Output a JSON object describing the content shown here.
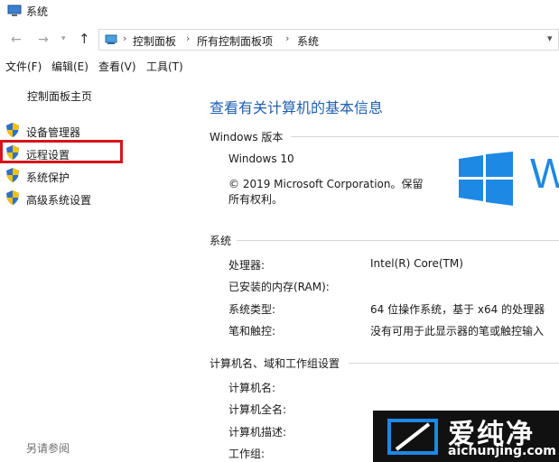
{
  "window": {
    "title": "系统"
  },
  "address": {
    "breadcrumb": [
      "控制面板",
      "所有控制面板项",
      "系统"
    ]
  },
  "menu": [
    "文件(F)",
    "编辑(E)",
    "查看(V)",
    "工具(T)"
  ],
  "sidebar": {
    "home": "控制面板主页",
    "links": [
      "设备管理器",
      "远程设置",
      "系统保护",
      "高级系统设置"
    ],
    "see_also": "另请参阅"
  },
  "main": {
    "title": "查看有关计算机的基本信息",
    "windows_section": {
      "title": "Windows 版本",
      "edition": "Windows 10",
      "copyright_line1": "© 2019 Microsoft Corporation。保留",
      "copyright_line2": "所有权利。",
      "logo_letter": "W"
    },
    "system_section": {
      "title": "系统",
      "rows": [
        {
          "label": "处理器:",
          "value": "Intel(R) Core(TM)"
        },
        {
          "label": "已安装的内存(RAM):",
          "value": ""
        },
        {
          "label": "系统类型:",
          "value": "64 位操作系统，基于 x64 的处理器"
        },
        {
          "label": "笔和触控:",
          "value": "没有可用于此显示器的笔或触控输入"
        }
      ]
    },
    "computer_section": {
      "title": "计算机名、域和工作组设置",
      "rows": [
        {
          "label": "计算机名:"
        },
        {
          "label": "计算机全名:"
        },
        {
          "label": "计算机描述:"
        },
        {
          "label": "工作组:"
        }
      ]
    }
  },
  "watermark": {
    "big": "爱纯净",
    "small": "aichunjing.com"
  },
  "colors": {
    "title_blue": "#1f5fb1",
    "highlight_red": "#d7141a",
    "win_blue": "#1e88e5"
  }
}
